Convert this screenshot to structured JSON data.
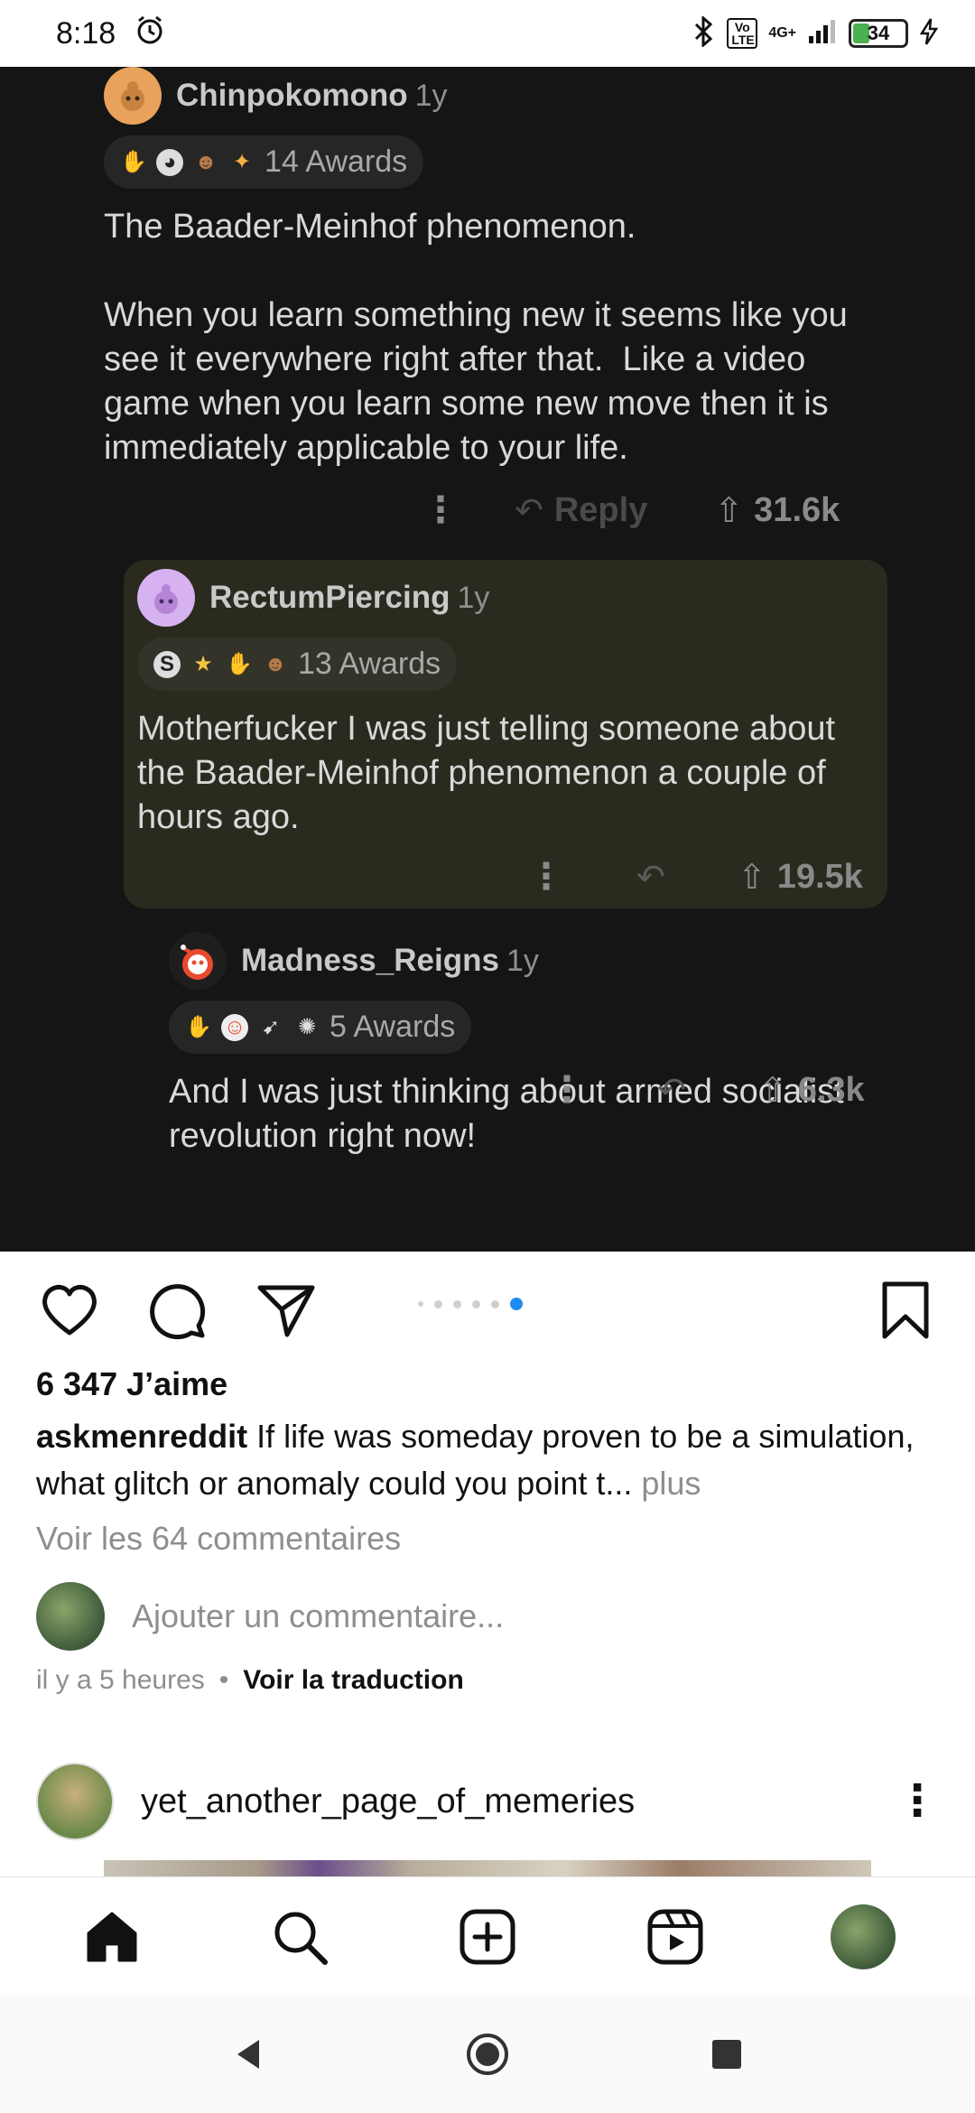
{
  "status_bar": {
    "time": "8:18",
    "network": "4G+",
    "volte": "Vo LTE",
    "battery": "34"
  },
  "post_image": {
    "comments": [
      {
        "username": "Chinpokomono",
        "age": "1y",
        "awards": "14 Awards",
        "body": "The Baader-Meinhof phenomenon.\n\nWhen you learn something new it seems like you see it everywhere right after that.  Like a video game when you learn some new move then it is immediately applicable to your life.",
        "reply_label": "Reply",
        "votes": "31.6k"
      },
      {
        "username": "RectumPiercing",
        "age": "1y",
        "awards": "13 Awards",
        "body": "Motherfucker I was just telling someone about the Baader-Meinhof phenomenon a couple of hours ago.",
        "votes": "19.5k"
      },
      {
        "username": "Madness_Reigns",
        "age": "1y",
        "awards": "5 Awards",
        "body": "And I was just thinking about armed socialist revolution right now!",
        "votes": "6.3k"
      }
    ]
  },
  "instagram": {
    "likes": "6 347 J’aime",
    "caption_user": "askmenreddit",
    "caption_text": " If life was someday proven to be a simulation, what glitch or anomaly could you point t...",
    "caption_more": " plus",
    "view_comments": "Voir les 64 commentaires",
    "add_comment_placeholder": "Ajouter un commentaire...",
    "time_ago": "il y a 5 heures",
    "separator": "•",
    "translate": "Voir la traduction",
    "next_post_user": "yet_another_page_of_memeries",
    "carousel_index": 6,
    "carousel_count": 6
  },
  "icons": {
    "like": "heart-icon",
    "comment": "comment-icon",
    "share": "send-icon",
    "save": "bookmark-icon",
    "home": "home-icon",
    "search": "search-icon",
    "create": "add-icon",
    "reels": "reels-icon",
    "back": "back-icon",
    "home_sys": "home-circle-icon",
    "recents": "recents-icon"
  },
  "colors": {
    "reddit_bg": "#151515",
    "nested_bg": "#2a2a1f",
    "carousel_active": "#1d8cf0",
    "battery": "#4caf50"
  }
}
